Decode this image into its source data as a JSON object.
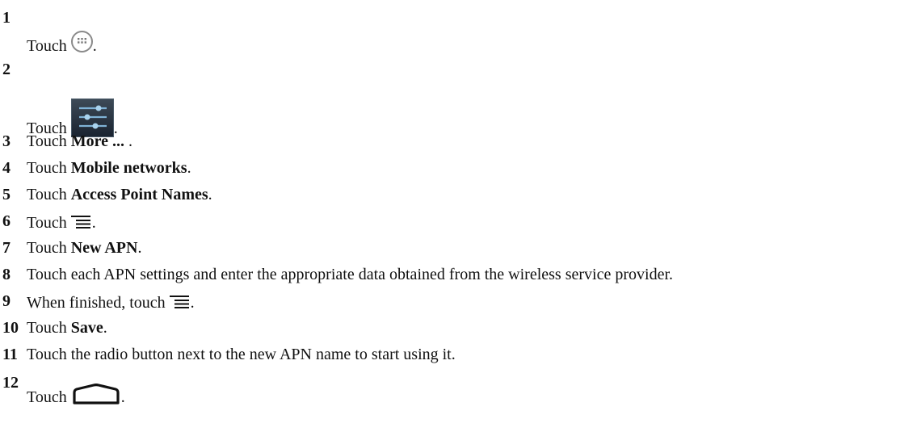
{
  "steps": [
    {
      "number": "1",
      "pre": "Touch",
      "post": "."
    },
    {
      "number": "2",
      "pre": "Touch",
      "post": "."
    },
    {
      "number": "3",
      "pre": "Touch",
      "bold": "More ...",
      "post": " ."
    },
    {
      "number": "4",
      "pre": "Touch",
      "bold": "Mobile networks",
      "post": "."
    },
    {
      "number": "5",
      "pre": "Touch",
      "bold": "Access Point Names",
      "post": "."
    },
    {
      "number": "6",
      "pre": "Touch",
      "post": "."
    },
    {
      "number": "7",
      "pre": "Touch",
      "bold": "New APN",
      "post": "."
    },
    {
      "number": "8",
      "text": "Touch each APN settings and enter the appropriate data obtained from the wireless service provider."
    },
    {
      "number": "9",
      "pre": "When finished, touch",
      "post": "."
    },
    {
      "number": "10",
      "pre": "Touch",
      "bold": "Save",
      "post": "."
    },
    {
      "number": "11",
      "text": "Touch the radio button next to the new APN name to start using it."
    },
    {
      "number": "12",
      "pre": "Touch",
      "post": "."
    }
  ],
  "icons": {
    "step1": "apps-icon",
    "step2": "settings-icon",
    "step6": "menu-icon",
    "step9": "menu-icon",
    "step12": "home-icon"
  }
}
